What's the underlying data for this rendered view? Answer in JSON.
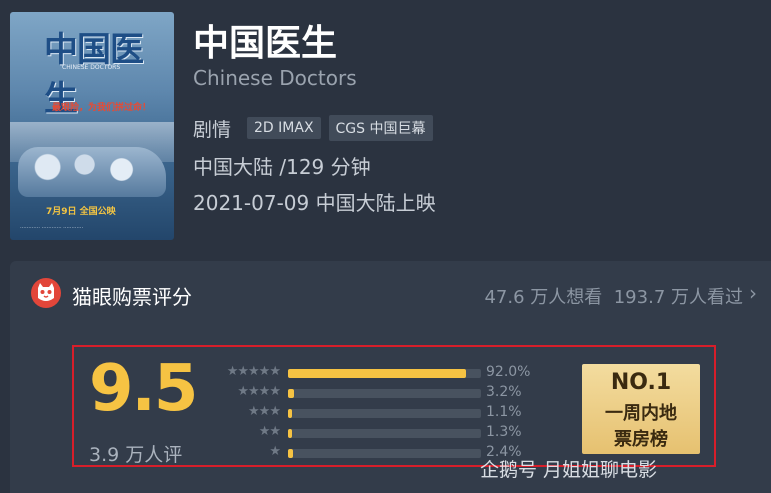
{
  "poster": {
    "title": "中国医生",
    "subtitle": "CHINESE DOCTORS",
    "slogan": "最艰险，为我们拼过命！",
    "release": "7月9日 全国公映"
  },
  "movie": {
    "title": "中国医生",
    "english_title": "Chinese Doctors",
    "genre": "剧情",
    "tags": [
      "2D IMAX",
      "CGS 中国巨幕"
    ],
    "region_duration": "中国大陆 /129 分钟",
    "release": "2021-07-09 中国大陆上映"
  },
  "rating": {
    "source_label": "猫眼购票评分",
    "want_to_see": "47.6 万人想看",
    "watched": "193.7 万人看过",
    "chevron": "›",
    "score": "9.5",
    "count": "3.9 万人评",
    "distribution": [
      {
        "stars": "★★★★★",
        "percent": "92.0%",
        "value": 92.0
      },
      {
        "stars": "★★★★",
        "percent": "3.2%",
        "value": 3.2
      },
      {
        "stars": "★★★",
        "percent": "1.1%",
        "value": 1.1
      },
      {
        "stars": "★★",
        "percent": "1.3%",
        "value": 1.3
      },
      {
        "stars": "★",
        "percent": "2.4%",
        "value": 2.4
      }
    ],
    "badge": {
      "rank": "NO.1",
      "line1": "一周内地",
      "line2": "票房榜"
    }
  },
  "watermark": "企鹅号 月姐姐聊电影",
  "colors": {
    "accent": "#f6c343",
    "highlight_border": "#d81e2a",
    "maoyan_red": "#e2463a"
  }
}
